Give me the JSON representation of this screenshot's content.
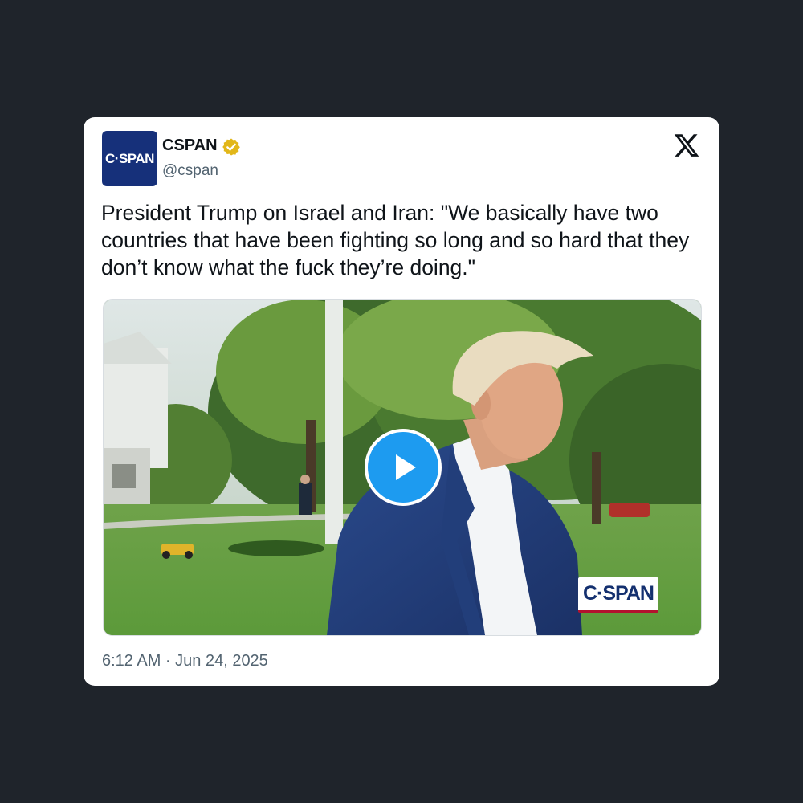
{
  "account": {
    "avatar_text": "C·SPAN",
    "display_name": "CSPAN",
    "handle": "@cspan",
    "verified_badge": "gold-verified-badge-icon"
  },
  "platform_logo": "x-logo-icon",
  "tweet": {
    "text": "President Trump on Israel and Iran: \"We basically have two countries that have been fighting so long and so hard that they don’t know what the fuck they’re doing.\"",
    "timestamp": "6:12 AM · Jun 24, 2025"
  },
  "media": {
    "type": "video",
    "play_icon": "play-icon",
    "watermark": "C·SPAN"
  },
  "colors": {
    "page_background": "#1f242b",
    "card_background": "#ffffff",
    "avatar_background": "#16307a",
    "play_button": "#1d9bf0",
    "verified_gold": "#e2b719",
    "secondary_text": "#536471"
  }
}
